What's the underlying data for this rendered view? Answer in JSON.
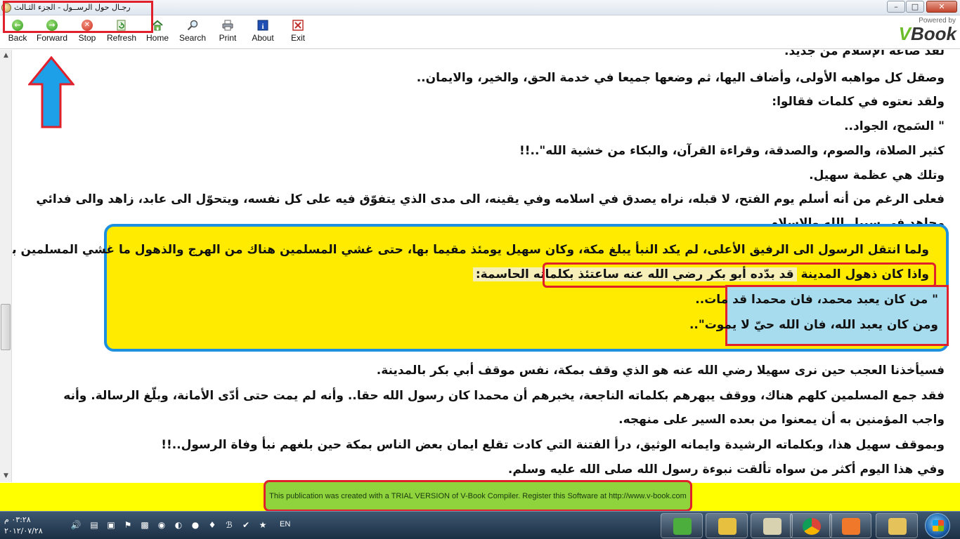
{
  "window": {
    "title": "رجـال حول الرســول  -   الجزء الثـالث"
  },
  "toolbar": {
    "buttons": [
      {
        "label": "Back",
        "icon": "back-arrow-icon"
      },
      {
        "label": "Forward",
        "icon": "forward-arrow-icon"
      },
      {
        "label": "Stop",
        "icon": "stop-icon"
      },
      {
        "label": "Refresh",
        "icon": "refresh-icon"
      },
      {
        "label": "Home",
        "icon": "home-icon"
      },
      {
        "label": "Search",
        "icon": "search-icon"
      },
      {
        "label": "Print",
        "icon": "printer-icon"
      },
      {
        "label": "About",
        "icon": "info-icon"
      },
      {
        "label": "Exit",
        "icon": "exit-icon"
      }
    ],
    "logo": {
      "powered": "Powered by",
      "brand_v": "V",
      "brand_rest": "Book"
    }
  },
  "content": {
    "lines": [
      "لقد صاغه الإسلام من جديد.",
      "وصقل كل مواهبه الأولى، وأضاف اليها، ثم وضعها جميعا في خدمة الحق، والخير، والايمان..",
      "ولقد نعتوه في كلمات فقالوا:",
      "\" السَمح، الجواد..",
      "كثير الصلاة، والصوم، والصدقة، وقراءة القرآن، والبكاء من خشية الله\"..!!",
      "وتلك هي عظمة سهيل.",
      "فعلى الرغم من أنه أسلم يوم الفتح، لا قبله، نراه يصدق في اسلامه وفي يقينه، الى مدى الذي يتفوّق فيه على كل نفسه، ويتحوّل الى عابد، زاهد والى فدائي مجاهد في سبيل الله والإسلام ."
    ],
    "highlight": {
      "line1": "ولما انتقل الرسول الى الرفيق الأعلى، لم يكد النبأ يبلغ مكة، وكان سهيل يومئذ مقيما بها، حتى غشي المسلمين هناك من الهرج والذهول ما غشي المسلمين بالمدينة.",
      "line2_start": "واذا كان ذهول المدينة",
      "line2_highlight": "قد بدّده أبو بكر رضي الله عنه ساعتئذ بكلماته الحاسمة:",
      "quote1": "\" من كان يعبد محمد، فان محمدا قد مات..",
      "quote2": "ومن كان يعبد الله، فان الله حيّ لا يموت\".."
    },
    "after": [
      "فسيأخذنا العجب حين نرى سهيلا رضي الله عنه هو الذي وقف بمكة، نفس موقف أبي بكر بالمدينة.",
      "فقد جمع المسلمين كلهم هناك، ووقف يبهرهم بكلماته الناجعة، يخبرهم أن محمدا كان رسول الله حقا.. وأنه لم يمت حتى أدّى الأمانة، وبلّغ الرسالة. وأنه واجب المؤمنين به أن يمعنوا من بعده السير على منهجه.",
      "وبموقف سهيل هذا، وبكلماته الرشيدة وايمانه الوثيق، درأ الفتنة التي كادت تقلع ايمان بعض الناس بمكة حين بلغهم نبأ وفاة الرسول..!!",
      "وفي هذا اليوم أكثر من سواه تألقت نبوءة رسول الله صلى الله عليه وسلم."
    ]
  },
  "trial": {
    "text": "This publication was created with a TRIAL VERSION of V-Book Compiler. Register this Software at http://www.v-book.com"
  },
  "taskbar": {
    "clock_time": "٠٣:٢٨ م",
    "clock_date": "٢٠١٢/٠٧/٢٨",
    "language": "EN"
  },
  "colors": {
    "highlight_bg": "#ffeb00",
    "highlight_border": "#1e90e0",
    "annotation_red": "#e0202a",
    "quote_bg": "#a7dcef",
    "trial_bar": "#ffff00",
    "trial_box": "#8fd43c"
  }
}
